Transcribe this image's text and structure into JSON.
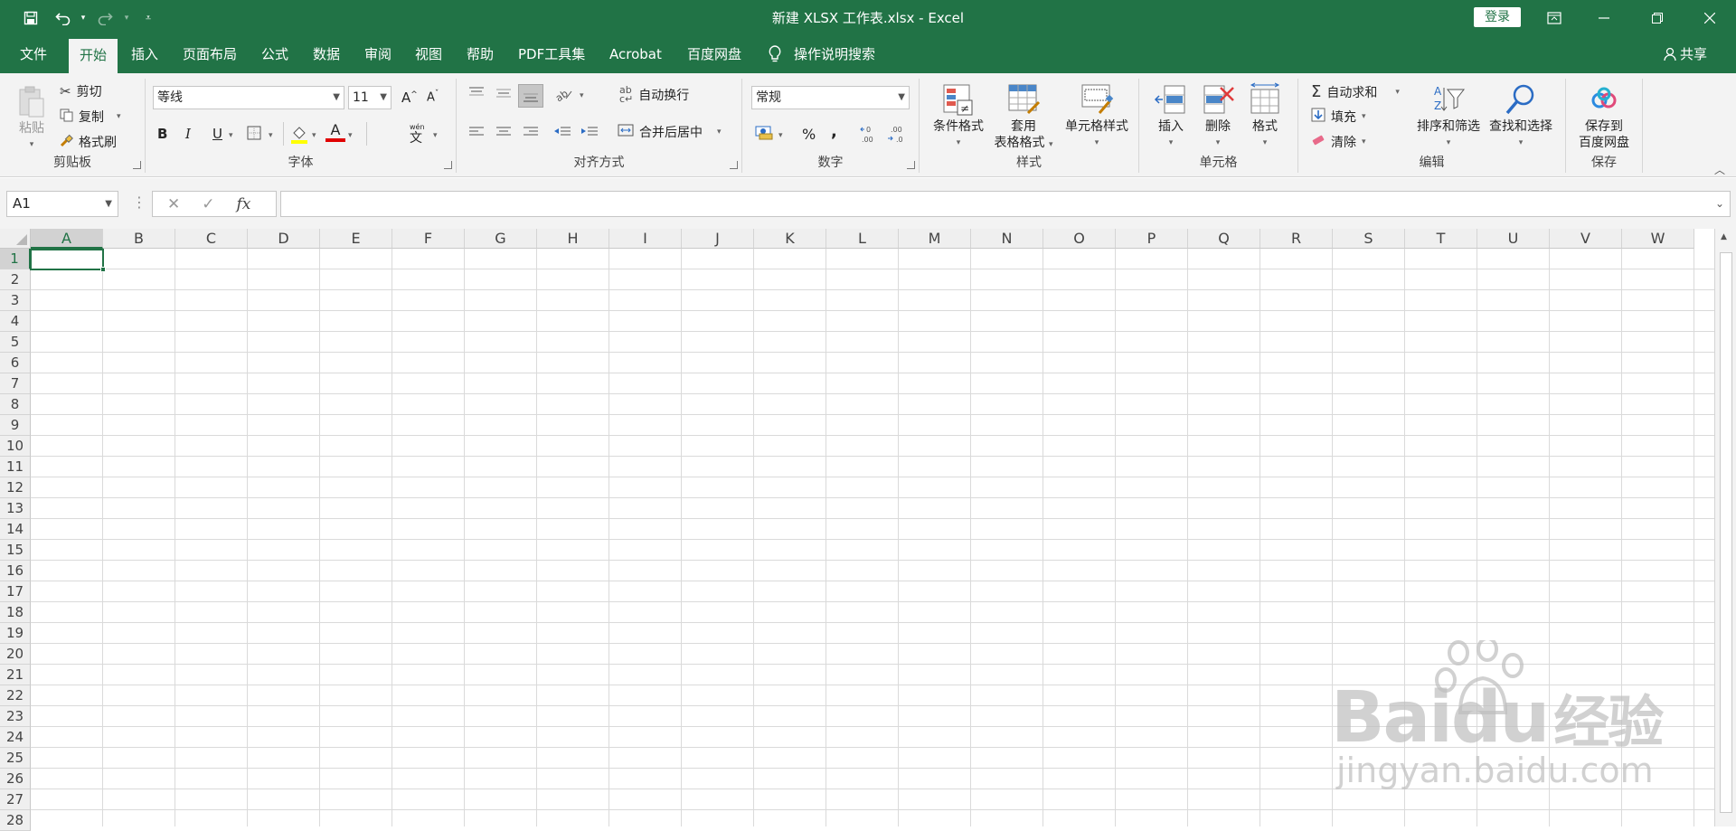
{
  "titlebar": {
    "title": "新建 XLSX 工作表.xlsx  -  Excel",
    "signin": "登录",
    "icons": [
      "save-icon",
      "undo-icon",
      "redo-icon",
      "customize-qat-icon"
    ]
  },
  "tabs": [
    "文件",
    "开始",
    "插入",
    "页面布局",
    "公式",
    "数据",
    "审阅",
    "视图",
    "帮助",
    "PDF工具集",
    "Acrobat",
    "百度网盘"
  ],
  "active_tab": "开始",
  "tell_me": "操作说明搜索",
  "share": "共享",
  "ribbon": {
    "clipboard": {
      "paste": "粘贴",
      "cut": "剪切",
      "copy": "复制",
      "format_painter": "格式刷",
      "label": "剪贴板"
    },
    "font": {
      "name": "等线",
      "size": "11",
      "bold": "B",
      "italic": "I",
      "underline": "U",
      "label": "字体",
      "grow": "A",
      "shrink": "A",
      "font_color": "A",
      "phonetic": "文"
    },
    "alignment": {
      "wrap_text": "自动换行",
      "merge_center": "合并后居中",
      "label": "对齐方式"
    },
    "number": {
      "format": "常规",
      "percent": "%",
      "comma": ",",
      "label": "数字"
    },
    "styles": {
      "conditional": "条件格式",
      "table_1": "套用",
      "table_2": "表格格式",
      "cell_styles": "单元格样式",
      "label": "样式"
    },
    "cells": {
      "insert": "插入",
      "delete": "删除",
      "format": "格式",
      "label": "单元格"
    },
    "editing": {
      "autosum": "自动求和",
      "fill": "填充",
      "clear": "清除",
      "sort_filter": "排序和筛选",
      "find_select": "查找和选择",
      "label": "编辑"
    },
    "save": {
      "save_1": "保存到",
      "save_2": "百度网盘",
      "label": "保存"
    }
  },
  "formula_bar": {
    "name_box": "A1",
    "fx": "fx",
    "cancel": "✕",
    "enter": "✓"
  },
  "sheet": {
    "columns": [
      "A",
      "B",
      "C",
      "D",
      "E",
      "F",
      "G",
      "H",
      "I",
      "J",
      "K",
      "L",
      "M",
      "N",
      "O",
      "P",
      "Q",
      "R",
      "S",
      "T",
      "U",
      "V",
      "W"
    ],
    "rows": [
      "1",
      "2",
      "3",
      "4",
      "5",
      "6",
      "7",
      "8",
      "9",
      "10",
      "11",
      "12",
      "13",
      "14",
      "15",
      "16",
      "17",
      "18",
      "19",
      "20",
      "21",
      "22",
      "23",
      "24",
      "25",
      "26",
      "27",
      "28"
    ],
    "active_cell": "A1"
  },
  "watermark": {
    "brand": "Baidu",
    "brand_cn": "经验",
    "url": "jingyan.baidu.com"
  },
  "colors": {
    "excel_green": "#217346",
    "ribbon_bg": "#f3f3f3",
    "gridline": "#dadada"
  }
}
